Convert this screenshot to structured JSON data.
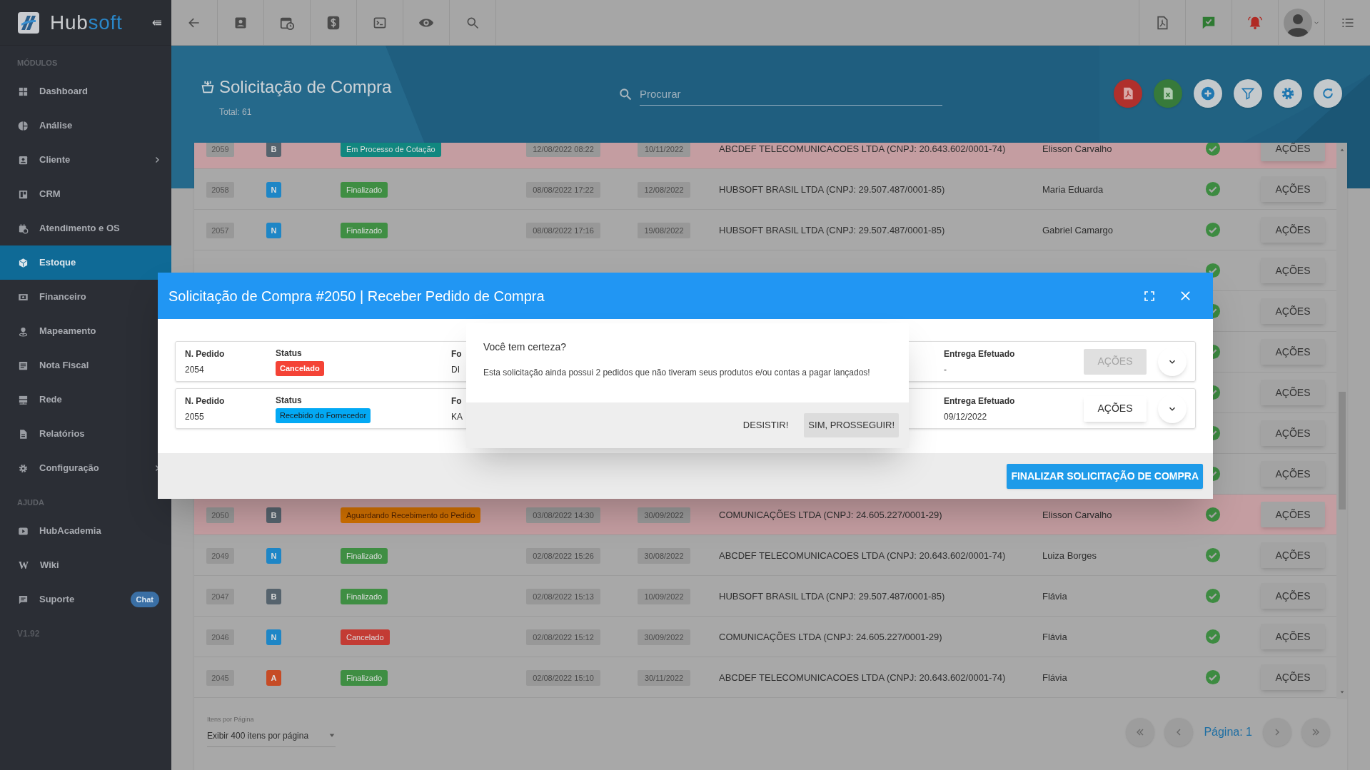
{
  "sidebar": {
    "brand": [
      "Hub",
      "soft"
    ],
    "sections": [
      {
        "heading": "MÓDULOS",
        "items": [
          {
            "label": "Dashboard",
            "selected": false,
            "expandable": false
          },
          {
            "label": "Análise",
            "selected": false,
            "expandable": false
          },
          {
            "label": "Cliente",
            "selected": false,
            "expandable": true
          },
          {
            "label": "CRM",
            "selected": false,
            "expandable": false
          },
          {
            "label": "Atendimento e OS",
            "selected": false,
            "expandable": false
          },
          {
            "label": "Estoque",
            "selected": true,
            "expandable": false
          },
          {
            "label": "Financeiro",
            "selected": false,
            "expandable": false
          },
          {
            "label": "Mapeamento",
            "selected": false,
            "expandable": false
          },
          {
            "label": "Nota Fiscal",
            "selected": false,
            "expandable": false
          },
          {
            "label": "Rede",
            "selected": false,
            "expandable": false
          },
          {
            "label": "Relatórios",
            "selected": false,
            "expandable": false
          },
          {
            "label": "Configuração",
            "selected": false,
            "expandable": true
          }
        ]
      },
      {
        "heading": "AJUDA",
        "items": [
          {
            "label": "HubAcademia",
            "selected": false,
            "expandable": false
          },
          {
            "label": "Wiki",
            "selected": false,
            "expandable": false,
            "glyph": "W"
          },
          {
            "label": "Suporte",
            "selected": false,
            "expandable": false,
            "badge": "Chat"
          }
        ]
      }
    ],
    "version": "V1.92"
  },
  "header": {
    "title": "Solicitação de Compra",
    "total": "Total: 61",
    "search": {
      "placeholder": "Procurar"
    }
  },
  "table": {
    "rows": [
      {
        "id": "2059",
        "type": {
          "text": "B",
          "color": "#56636d"
        },
        "status": {
          "text": "Em Processo de Cotação",
          "color": "#11877f"
        },
        "created": "12/08/2022 08:22",
        "due": "10/11/2022",
        "supplier": "ABCDEF TELECOMUNICACOES LTDA (CNPJ: 20.643.602/0001-74)",
        "requester": "Elisson Carvalho",
        "highlighted": true,
        "action": "AÇÕES"
      },
      {
        "id": "2058",
        "type": {
          "text": "N",
          "color": "#1e86c6"
        },
        "status": {
          "text": "Finalizado",
          "color": "#3f8e43"
        },
        "created": "08/08/2022 17:22",
        "due": "12/08/2022",
        "supplier": "HUBSOFT BRASIL LTDA (CNPJ: 29.507.487/0001-85)",
        "requester": "Maria Eduarda",
        "highlighted": false,
        "action": "AÇÕES"
      },
      {
        "id": "2057",
        "type": {
          "text": "N",
          "color": "#1e86c6"
        },
        "status": {
          "text": "Finalizado",
          "color": "#3f8e43"
        },
        "created": "08/08/2022 17:16",
        "due": "19/08/2022",
        "supplier": "HUBSOFT BRASIL LTDA (CNPJ: 29.507.487/0001-85)",
        "requester": "Gabriel Camargo",
        "highlighted": false,
        "action": "AÇÕES"
      },
      {
        "highlighted": false,
        "action": "AÇÕES"
      },
      {
        "highlighted": false,
        "action": "AÇÕES"
      },
      {
        "highlighted": false,
        "action": "AÇÕES"
      },
      {
        "highlighted": false,
        "action": "AÇÕES"
      },
      {
        "highlighted": false,
        "action": "AÇÕES"
      },
      {
        "highlighted": false,
        "action": "AÇÕES"
      },
      {
        "id": "2050",
        "type": {
          "text": "B",
          "color": "#56636d"
        },
        "status": {
          "text": "Aguardando Recebimento do Pedido",
          "color": "#d07000"
        },
        "created": "03/08/2022 14:30",
        "due": "30/09/2022",
        "supplier": "COMUNICAÇÕES LTDA (CNPJ: 24.605.227/0001-29)",
        "requester": "Elisson Carvalho",
        "highlighted": true,
        "action": "AÇÕES"
      },
      {
        "id": "2049",
        "type": {
          "text": "N",
          "color": "#1e86c6"
        },
        "status": {
          "text": "Finalizado",
          "color": "#3f8e43"
        },
        "created": "02/08/2022 15:26",
        "due": "30/08/2022",
        "supplier": "ABCDEF TELECOMUNICACOES LTDA (CNPJ: 20.643.602/0001-74)",
        "requester": "Luiza Borges",
        "highlighted": false,
        "action": "AÇÕES"
      },
      {
        "id": "2047",
        "type": {
          "text": "B",
          "color": "#56636d"
        },
        "status": {
          "text": "Finalizado",
          "color": "#3f8e43"
        },
        "created": "02/08/2022 15:13",
        "due": "10/09/2022",
        "supplier": "HUBSOFT BRASIL LTDA (CNPJ: 29.507.487/0001-85)",
        "requester": "Flávia",
        "highlighted": false,
        "action": "AÇÕES"
      },
      {
        "id": "2046",
        "type": {
          "text": "N",
          "color": "#1e86c6"
        },
        "status": {
          "text": "Cancelado",
          "color": "#c33b34"
        },
        "created": "02/08/2022 15:12",
        "due": "30/09/2022",
        "supplier": "COMUNICAÇÕES LTDA (CNPJ: 24.605.227/0001-29)",
        "requester": "Flávia",
        "highlighted": false,
        "action": "AÇÕES"
      },
      {
        "id": "2045",
        "type": {
          "text": "A",
          "color": "#c64b25"
        },
        "status": {
          "text": "Finalizado",
          "color": "#3f8e43"
        },
        "created": "02/08/2022 15:10",
        "due": "30/11/2022",
        "supplier": "ABCDEF TELECOMUNICACOES LTDA (CNPJ: 20.643.602/0001-74)",
        "requester": "Flávia",
        "highlighted": false,
        "action": "AÇÕES"
      }
    ],
    "pagination": {
      "per_page_label": "Itens por Página",
      "per_page_value": "Exibir 400 itens por página",
      "page": "Página: 1"
    }
  },
  "modal": {
    "title": "Solicitação de Compra #2050 | Receber Pedido de Compra",
    "orders": [
      {
        "order_label": "N. Pedido",
        "order": "2054",
        "status_label": "Status",
        "status": {
          "text": "Cancelado",
          "color": "#f44336"
        },
        "supplier_label": "Fo",
        "supplier": "DI",
        "delivery_label": "Entrega Efetuado",
        "delivery": "-",
        "action": {
          "label": "AÇÕES",
          "disabled": true
        }
      },
      {
        "order_label": "N. Pedido",
        "order": "2055",
        "status_label": "Status",
        "status": {
          "text": "Recebido do Fornecedor",
          "color": "#03a9f4"
        },
        "supplier_label": "Fo",
        "supplier": "KA",
        "delivery_label": "Entrega Efetuado",
        "delivery": "09/12/2022",
        "action": {
          "label": "AÇÕES",
          "disabled": false
        }
      }
    ],
    "finish_button": "FINALIZAR SOLICITAÇÃO DE COMPRA",
    "confirm": {
      "title": "Você tem certeza?",
      "message": "Esta solicitação ainda possui 2 pedidos que não tiveram seus produtos e/ou contas a pagar lançados!",
      "buttons": [
        {
          "label": "DESISTIR!",
          "kind": "flat"
        },
        {
          "label": "SIM, PROSSEGUIR!",
          "kind": "raised"
        }
      ]
    }
  }
}
